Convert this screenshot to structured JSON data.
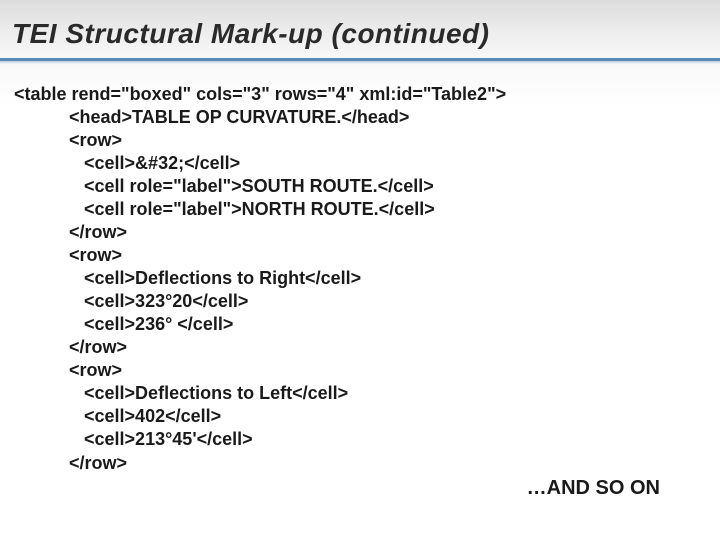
{
  "slide": {
    "title": "TEI Structural Mark-up (continued)",
    "code_lines": [
      "<table rend=\"boxed\" cols=\"3\" rows=\"4\" xml:id=\"Table2\">",
      "           <head>TABLE OP CURVATURE.</head>",
      "           <row>",
      "              <cell>&#32;</cell>",
      "              <cell role=\"label\">SOUTH ROUTE.</cell>",
      "              <cell role=\"label\">NORTH ROUTE.</cell>",
      "           </row>",
      "           <row>",
      "              <cell>Deflections to Right</cell>",
      "              <cell>323°20</cell>",
      "              <cell>236° </cell>",
      "           </row>",
      "           <row>",
      "              <cell>Deflections to Left</cell>",
      "              <cell>402</cell>",
      "              <cell>213°45'</cell>",
      "           </row>"
    ],
    "footer": "…AND SO ON"
  }
}
